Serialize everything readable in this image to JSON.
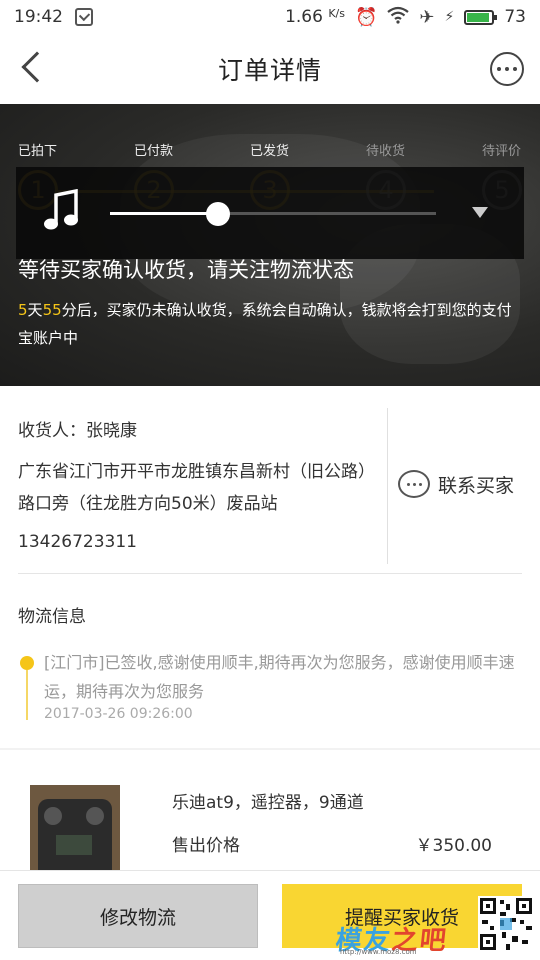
{
  "status_bar": {
    "time": "19:42",
    "speed": "1.66",
    "speed_unit": "K/s",
    "battery": "73"
  },
  "header": {
    "title": "订单详情"
  },
  "progress": {
    "steps": [
      {
        "label": "已拍下",
        "num": "1",
        "done": true
      },
      {
        "label": "已付款",
        "num": "2",
        "done": true
      },
      {
        "label": "已发货",
        "num": "3",
        "done": true
      },
      {
        "label": "待收货",
        "num": "4",
        "done": false
      },
      {
        "label": "待评价",
        "num": "5",
        "done": false
      }
    ]
  },
  "media_player": {
    "progress": 0.4
  },
  "banner": {
    "headline": "等待买家确认收货，请关注物流状态",
    "desc_days": "5",
    "desc_days_unit": "天",
    "desc_minutes": "55",
    "desc_rest": "分后，买家仍未确认收货，系统会自动确认，钱款将会打到您的支付宝账户中"
  },
  "receiver": {
    "name_line": "收货人：张晓康",
    "address": "广东省江门市开平市龙胜镇东昌新村（旧公路）路口旁（往龙胜方向50米）废品站",
    "phone": "13426723311",
    "contact_label": "联系买家"
  },
  "logistics": {
    "title": "物流信息",
    "latest": "[江门市]已签收,感谢使用顺丰,期待再次为您服务，感谢使用顺丰速运，期待再次为您服务",
    "time": "2017-03-26 09:26:00"
  },
  "product": {
    "name": "乐迪at9，遥控器，9通道",
    "price_label": "售出价格",
    "price": "￥350.00"
  },
  "actions": {
    "modify_label": "修改物流",
    "remind_label": "提醒买家收货"
  },
  "watermark": {
    "text_a": "模友",
    "text_b": "之吧",
    "url": "http://www.moz8.com"
  },
  "colors": {
    "accent": "#f9d632",
    "highlight": "#f5c518"
  }
}
